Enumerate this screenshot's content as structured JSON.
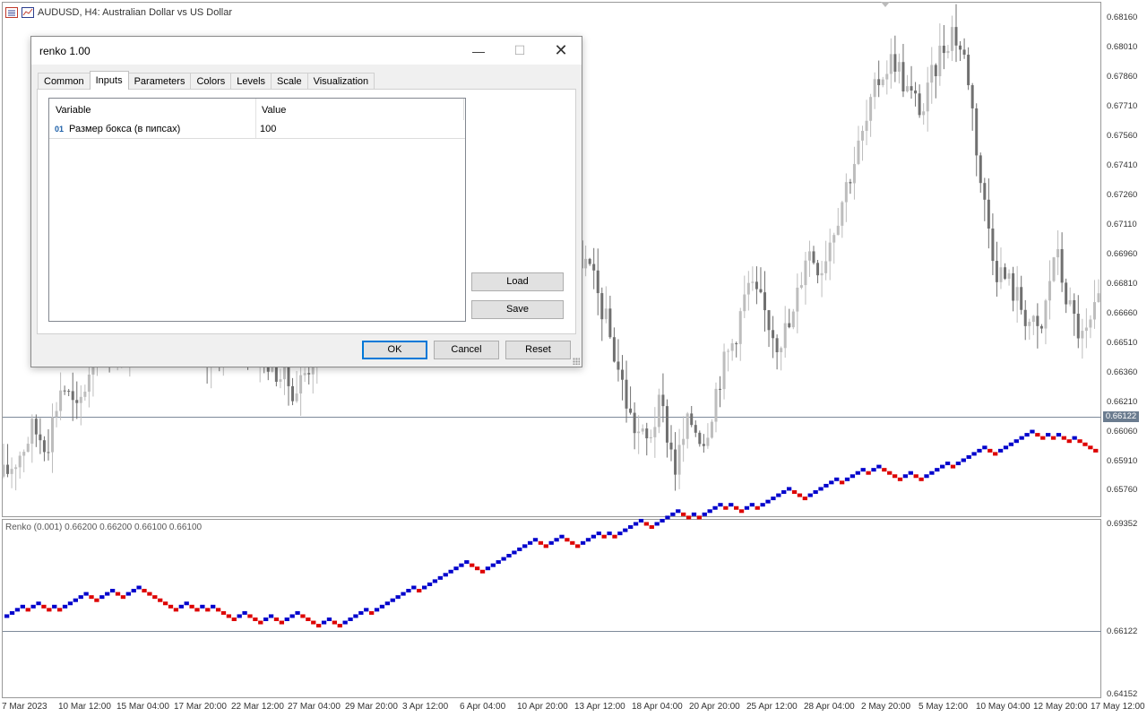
{
  "window": {
    "title": "AUDUSD, H4:  Australian Dollar vs US Dollar"
  },
  "indicator": {
    "label": "Renko (0.001) 0.66200 0.66200 0.66100 0.66100"
  },
  "price_axis_main": [
    "0.68160",
    "0.68010",
    "0.67860",
    "0.67710",
    "0.67560",
    "0.67410",
    "0.67260",
    "0.67110",
    "0.66960",
    "0.66810",
    "0.66660",
    "0.66510",
    "0.66360",
    "0.66210",
    "0.66060",
    "0.65910",
    "0.65760"
  ],
  "price_axis_sub": [
    "0.69352",
    "0.66122",
    "0.64152"
  ],
  "current_price": "0.66122",
  "time_axis": [
    "7 Mar 2023",
    "10 Mar 12:00",
    "15 Mar 04:00",
    "17 Mar 20:00",
    "22 Mar 12:00",
    "27 Mar 04:00",
    "29 Mar 20:00",
    "3 Apr 12:00",
    "6 Apr 04:00",
    "10 Apr 20:00",
    "13 Apr 12:00",
    "18 Apr 04:00",
    "20 Apr 20:00",
    "25 Apr 12:00",
    "28 Apr 04:00",
    "2 May 20:00",
    "5 May 12:00",
    "10 May 04:00",
    "12 May 20:00",
    "17 May 12:00"
  ],
  "colors": {
    "bull": "#0000cc",
    "bear": "#dd0000",
    "candle_up": "#bdbdbd",
    "candle_down": "#707070",
    "price_line": "#7e8a9a"
  },
  "dialog": {
    "title": "renko 1.00",
    "tabs": [
      "Common",
      "Inputs",
      "Parameters",
      "Colors",
      "Levels",
      "Scale",
      "Visualization"
    ],
    "active_tab": "Inputs",
    "columns": {
      "variable": "Variable",
      "value": "Value"
    },
    "rows": [
      {
        "type_icon": "01",
        "name": "Размер бокса (в пипсах)",
        "value": "100"
      }
    ],
    "buttons": {
      "load": "Load",
      "save": "Save",
      "ok": "OK",
      "cancel": "Cancel",
      "reset": "Reset"
    },
    "window_buttons": {
      "minimize": "—",
      "maximize": "☐",
      "close": "✕"
    }
  },
  "chart_data": [
    {
      "type": "candlestick",
      "title": "AUDUSD, H4:  Australian Dollar vs US Dollar",
      "ylim": [
        0.6563,
        0.6825
      ],
      "series": [
        {
          "name": "AUDUSD",
          "close": [
            0.658,
            0.6591,
            0.6605,
            0.6598,
            0.663,
            0.6612,
            0.664,
            0.6655,
            0.6641,
            0.666,
            0.6672,
            0.665,
            0.6664,
            0.6645,
            0.6638,
            0.6652,
            0.666,
            0.6647,
            0.6642,
            0.6633,
            0.6625,
            0.664,
            0.6664,
            0.6706,
            0.673,
            0.677,
            0.68,
            0.6775,
            0.6749,
            0.671,
            0.67,
            0.6718,
            0.6726,
            0.673,
            0.6722,
            0.674,
            0.6753,
            0.6748,
            0.6716,
            0.67,
            0.669,
            0.6668,
            0.664,
            0.6609,
            0.6597,
            0.6618,
            0.6585,
            0.661,
            0.66,
            0.6632,
            0.6652,
            0.668,
            0.6668,
            0.6652,
            0.666,
            0.67,
            0.669,
            0.6715,
            0.674,
            0.6762,
            0.679,
            0.68,
            0.678,
            0.6772,
            0.68,
            0.6815,
            0.6795,
            0.673,
            0.669,
            0.668,
            0.6665,
            0.6652,
            0.67,
            0.6668,
            0.665,
            0.667
          ]
        }
      ]
    },
    {
      "type": "renko",
      "title": "Renko (0.001) 0.66200 0.66200 0.66100 0.66100",
      "box_size": 0.001,
      "ylim": [
        0.6415,
        0.6935
      ],
      "bricks": [
        1,
        1,
        1,
        1,
        -1,
        1,
        1,
        -1,
        -1,
        1,
        -1,
        1,
        1,
        1,
        1,
        1,
        -1,
        -1,
        1,
        1,
        1,
        -1,
        -1,
        1,
        1,
        1,
        -1,
        -1,
        -1,
        -1,
        -1,
        -1,
        -1,
        1,
        1,
        -1,
        -1,
        1,
        -1,
        1,
        -1,
        -1,
        -1,
        -1,
        1,
        1,
        -1,
        -1,
        -1,
        1,
        1,
        -1,
        -1,
        1,
        1,
        1,
        -1,
        -1,
        -1,
        -1,
        1,
        1,
        -1,
        -1,
        1,
        1,
        1,
        1,
        1,
        -1,
        1,
        1,
        1,
        1,
        1,
        1,
        1,
        1,
        -1,
        1,
        1,
        1,
        1,
        1,
        1,
        1,
        1,
        1,
        -1,
        -1,
        -1,
        1,
        1,
        1,
        1,
        1,
        1,
        1,
        1,
        1,
        1,
        -1,
        -1,
        1,
        1,
        1,
        -1,
        -1,
        -1,
        1,
        1,
        1,
        1,
        -1,
        1,
        -1,
        1,
        1,
        1,
        1,
        1,
        -1,
        -1,
        1,
        1,
        1,
        1,
        1,
        -1,
        -1,
        1,
        -1,
        1,
        1,
        1,
        1,
        -1,
        1,
        -1,
        -1,
        1,
        1,
        -1,
        1,
        1,
        1,
        1,
        1,
        1,
        -1,
        -1,
        -1,
        1,
        1,
        1,
        1,
        1,
        1,
        -1,
        1,
        1,
        1,
        1,
        -1,
        1,
        1,
        -1,
        -1,
        -1,
        -1,
        1,
        1,
        -1,
        -1,
        1,
        1,
        1,
        1,
        1,
        -1,
        1,
        1,
        1,
        1,
        1,
        1,
        -1,
        -1,
        1,
        1,
        1,
        1,
        1,
        1,
        1,
        -1,
        -1,
        1,
        -1,
        1,
        -1,
        -1,
        1,
        -1,
        -1,
        -1,
        -1
      ]
    }
  ]
}
